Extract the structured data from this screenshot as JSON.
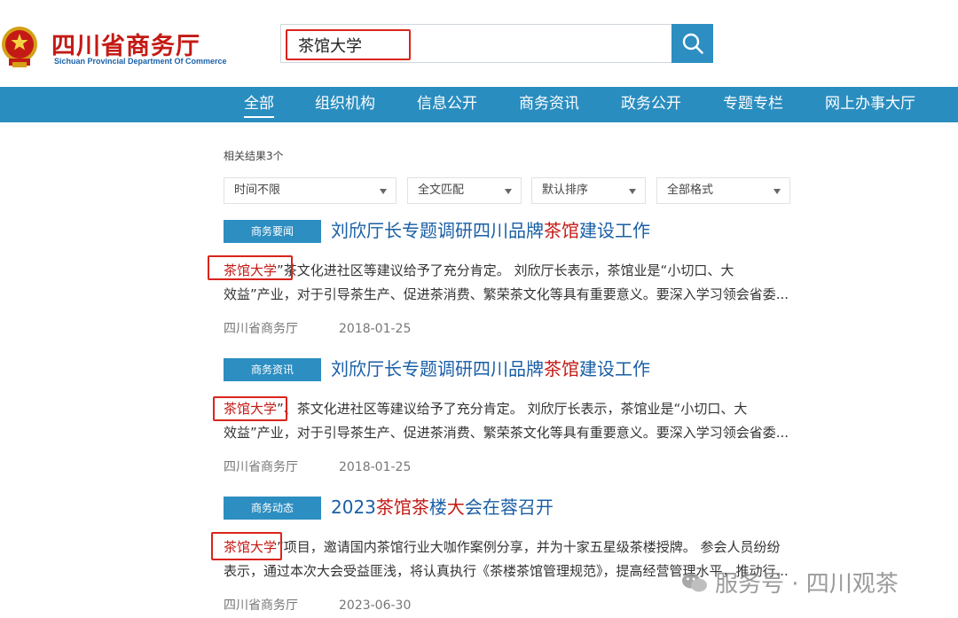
{
  "header": {
    "site_title": "四川省商务厅",
    "site_subtitle": "Sichuan Provincial Department Of Commerce"
  },
  "search": {
    "value": "茶馆大学"
  },
  "nav": {
    "items": [
      "全部",
      "组织机构",
      "信息公开",
      "商务资讯",
      "政务公开",
      "专题专栏",
      "网上办事大厅"
    ],
    "active": "全部"
  },
  "results_count": "相关结果3个",
  "filters": [
    "时间不限",
    "全文匹配",
    "默认排序",
    "全部格式"
  ],
  "results": [
    {
      "tag": "商务要闻",
      "title_parts": [
        "刘欣厅长专题调研四川品牌",
        "茶馆",
        "建设工作"
      ],
      "keyword": "茶馆大学",
      "line1_rest": "”茶文化进社区等建议给予了充分肯定。    刘欣厅长表示，茶馆业是“小切口、大",
      "line2": "效益”产业，对于引导茶生产、促进茶消费、繁荣茶文化等具有重要意义。要深入学习领会省委...",
      "source": "四川省商务厅",
      "date": "2018-01-25"
    },
    {
      "tag": "商务资讯",
      "title_parts": [
        "刘欣厅长专题调研四川品牌",
        "茶馆",
        "建设工作"
      ],
      "keyword": "茶馆大学",
      "line1_rest": "”、茶文化进社区等建议给予了充分肯定。    刘欣厅长表示，茶馆业是“小切口、大",
      "line2": "效益”产业，对于引导茶生产、促进茶消费、繁荣茶文化等具有重要意义。要深入学习领会省委...",
      "source": "四川省商务厅",
      "date": "2018-01-25"
    },
    {
      "tag": "商务动态",
      "title_parts": [
        "2023",
        "茶馆茶",
        "楼",
        "大",
        "会在蓉召开"
      ],
      "keyword": "茶馆大学",
      "line1_rest": "”项目，邀请国内茶馆行业大咖作案例分享，并为十家五星级茶楼授牌。 参会人员纷纷",
      "line2": "表示，通过本次大会受益匪浅，将认真执行《茶楼茶馆管理规范》，提高经营管理水平，推动行...",
      "source": "四川省商务厅",
      "date": "2023-06-30"
    }
  ],
  "watermark": "服务号 · 四川观茶",
  "colors": {
    "accent": "#2a8dbf",
    "brand_red": "#c41a15",
    "link_blue": "#1a5fa6",
    "highlight_box": "#d9241c"
  }
}
